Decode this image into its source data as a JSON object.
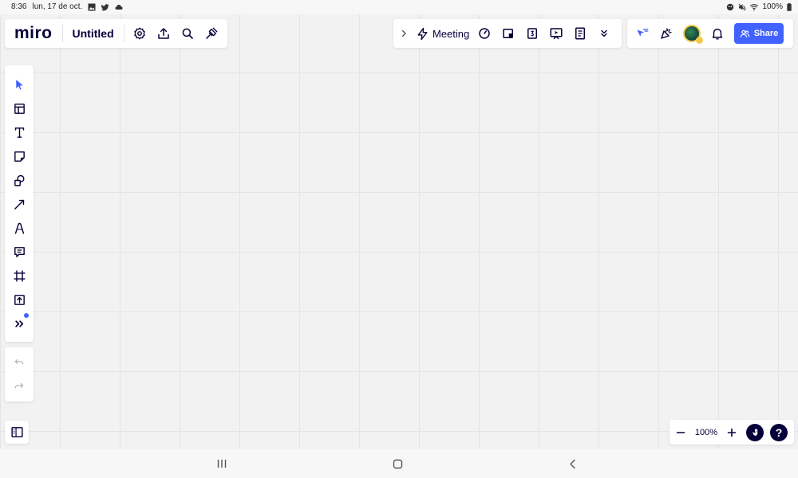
{
  "status_bar": {
    "time": "8:36",
    "date": "lun, 17 de oct.",
    "battery": "100%",
    "icons_left": [
      "gallery-icon",
      "twitter-icon",
      "cloud-icon"
    ],
    "icons_right": [
      "face-icon",
      "mute-icon",
      "wifi-icon",
      "battery-icon"
    ]
  },
  "board": {
    "logo": "miro",
    "title": "Untitled",
    "actions": [
      "settings-icon",
      "upload-icon",
      "search-icon",
      "plugin-icon"
    ]
  },
  "collab": {
    "meeting_label": "Meeting",
    "icons": [
      "chevron-right-icon",
      "lightning-icon",
      "timer-icon",
      "card-icon",
      "vote-icon",
      "presentation-icon",
      "notes-icon",
      "double-chevron-down-icon"
    ]
  },
  "top_right": {
    "share_label": "Share",
    "icons": [
      "cursor-reactions-icon",
      "celebrate-icon",
      "avatar",
      "bell-icon",
      "people-icon"
    ]
  },
  "tools": [
    "select-icon",
    "template-icon",
    "text-icon",
    "sticky-note-icon",
    "shapes-icon",
    "arrow-icon",
    "pen-icon",
    "comment-icon",
    "frame-icon",
    "upload-icon",
    "more-icon"
  ],
  "history": [
    "undo-icon",
    "redo-icon"
  ],
  "zoom": {
    "value": "100%",
    "help": "?"
  },
  "colors": {
    "accent": "#4262ff",
    "ink": "#050038",
    "canvas": "#f2f2f2"
  }
}
